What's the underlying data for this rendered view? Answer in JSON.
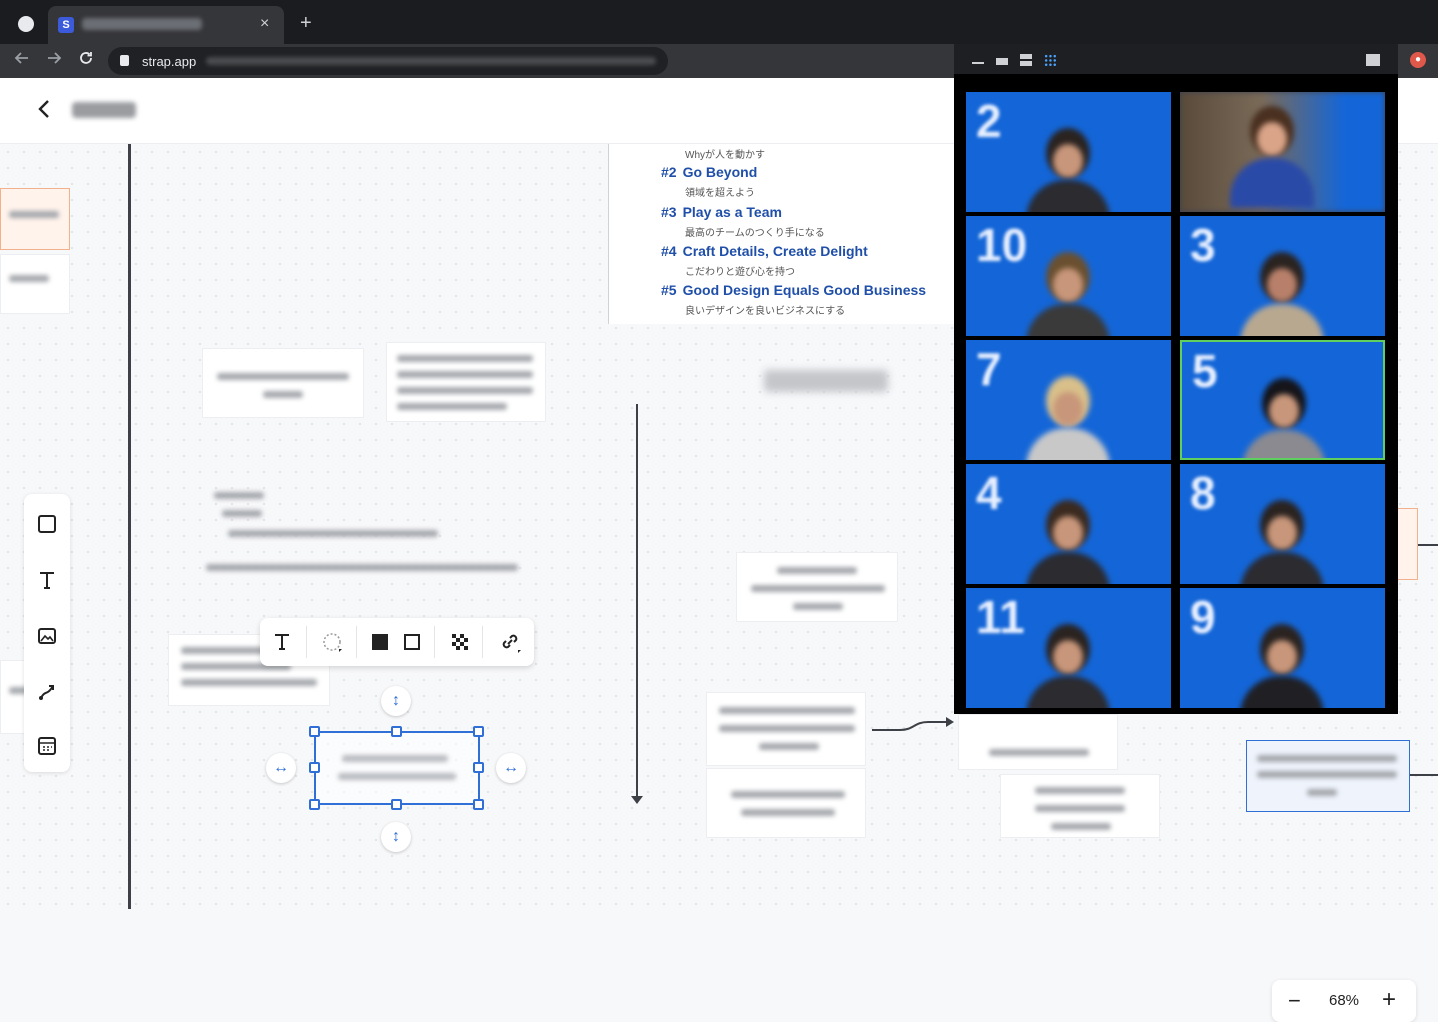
{
  "browser": {
    "url": "strap.app",
    "tab_favicon": "S",
    "tab_close": "×",
    "new_tab": "+"
  },
  "values": {
    "first_sub": "Whyが人を動かす",
    "items": [
      {
        "num": "#2",
        "title": "Go Beyond",
        "sub": "領域を超えよう"
      },
      {
        "num": "#3",
        "title": "Play as a Team",
        "sub": "最高のチームのつくり手になる"
      },
      {
        "num": "#4",
        "title": "Craft Details, Create Delight",
        "sub": "こだわりと遊び心を持つ"
      },
      {
        "num": "#5",
        "title": "Good Design Equals Good Business",
        "sub": "良いデザインを良いビジネスにする"
      }
    ]
  },
  "video": {
    "tiles": [
      "2",
      "",
      "10",
      "3",
      "7",
      "5",
      "4",
      "8",
      "11",
      "9"
    ],
    "tile_color": "#1466d8"
  },
  "zoom": {
    "value": "68%",
    "minus": "−",
    "plus": "+"
  },
  "icons": [
    "globe-icon",
    "back-arrow-icon",
    "rectangle-tool-icon",
    "text-tool-icon",
    "image-tool-icon",
    "connector-tool-icon",
    "table-tool-icon",
    "fill-icon",
    "border-icon",
    "link-icon"
  ],
  "accent_color": "#2f6fd6",
  "values_color": "#1f4fa8"
}
